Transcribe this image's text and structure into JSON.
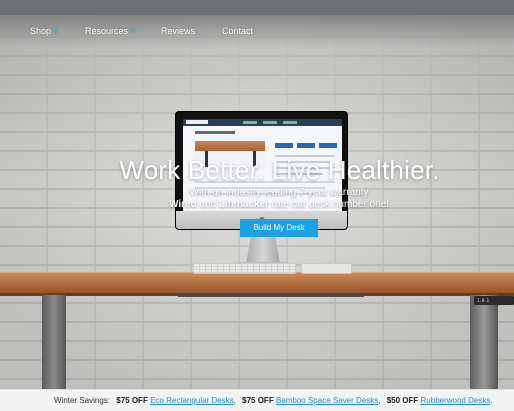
{
  "nav": {
    "items": [
      {
        "label": "Shop",
        "has_dropdown": true
      },
      {
        "label": "Resources",
        "has_dropdown": true
      },
      {
        "label": "Reviews",
        "has_dropdown": false
      },
      {
        "label": "Contact",
        "has_dropdown": false
      }
    ],
    "dropdown_icon": "chevron-down-icon",
    "accent_color": "#3fb1e8"
  },
  "hero": {
    "title": "Work Better. Live Healthier.",
    "subtitle_line1": "With an industry leading 7-year warranty",
    "subtitle_line2_bold1": "Wired",
    "subtitle_line2_and": " and ",
    "subtitle_line2_bold2": "Lifehacker",
    "subtitle_line2_rest": " rate our desk number one!",
    "cta_label": "Build My Desk",
    "cta_color": "#1ba1e2"
  },
  "desk_controller": {
    "display": "1.8.1"
  },
  "promo": {
    "label": "Winter Savings:",
    "offers": [
      {
        "price": "$75 OFF",
        "link": "Eco Rectangular Desks",
        "suffix": ","
      },
      {
        "price": "$75 OFF",
        "link": "Bamboo Space Saver Desks",
        "suffix": ","
      },
      {
        "price": "$50 OFF",
        "link": "Rubberwood Desks",
        "suffix": "."
      }
    ],
    "link_color": "#1c8fd0"
  }
}
